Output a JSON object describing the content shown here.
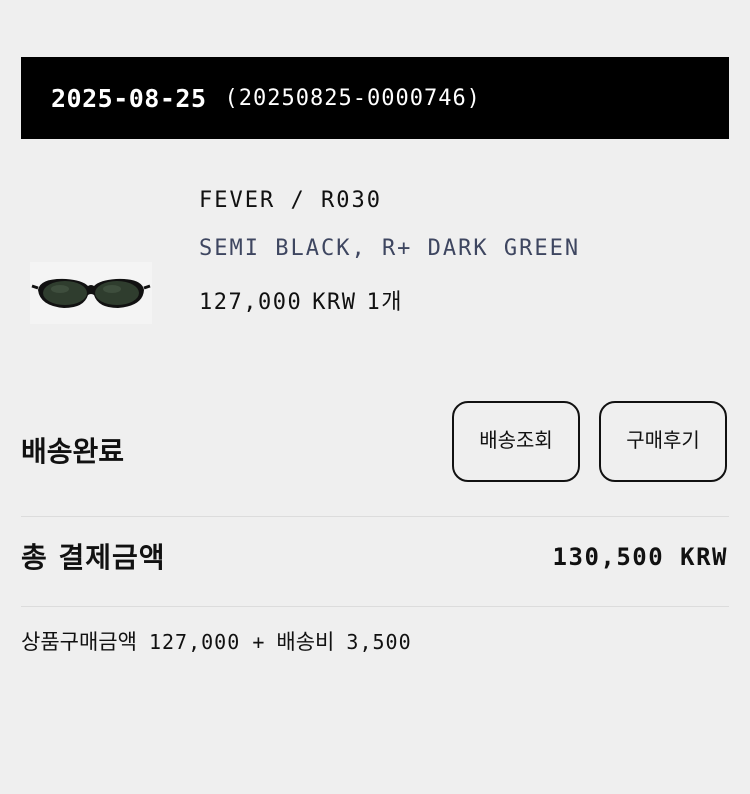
{
  "order": {
    "date": "2025-08-25",
    "number": "(20250825-0000746)"
  },
  "product": {
    "image_icon": "sunglasses-icon",
    "name": "FEVER / R030",
    "option": "SEMI BLACK, R+ DARK GREEN",
    "price": "127,000",
    "currency": "KRW",
    "quantity": "1개"
  },
  "status": {
    "label": "배송완료",
    "track_button": "배송조회",
    "review_button": "구매후기"
  },
  "payment": {
    "total_label": "총 결제금액",
    "total_amount": "130,500 KRW",
    "product_amount_label": "상품구매금액",
    "product_amount": "127,000",
    "plus": "+",
    "shipping_label": "배송비",
    "shipping_amount": "3,500"
  },
  "colors": {
    "header_bg": "#000000",
    "background": "#efefef",
    "option_text": "#3e4660"
  }
}
